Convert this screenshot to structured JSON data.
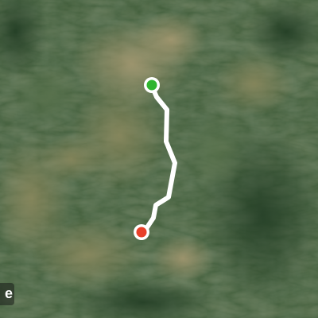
{
  "map": {
    "type": "satellite",
    "colors": {
      "route": "#ffffff",
      "start_marker": "#2fb52f",
      "end_marker": "#e8402a",
      "marker_ring": "#ffffff"
    },
    "attribution": "e"
  },
  "route": {
    "start_marker_icon": "green-circle",
    "end_marker_icon": "red-circle"
  }
}
